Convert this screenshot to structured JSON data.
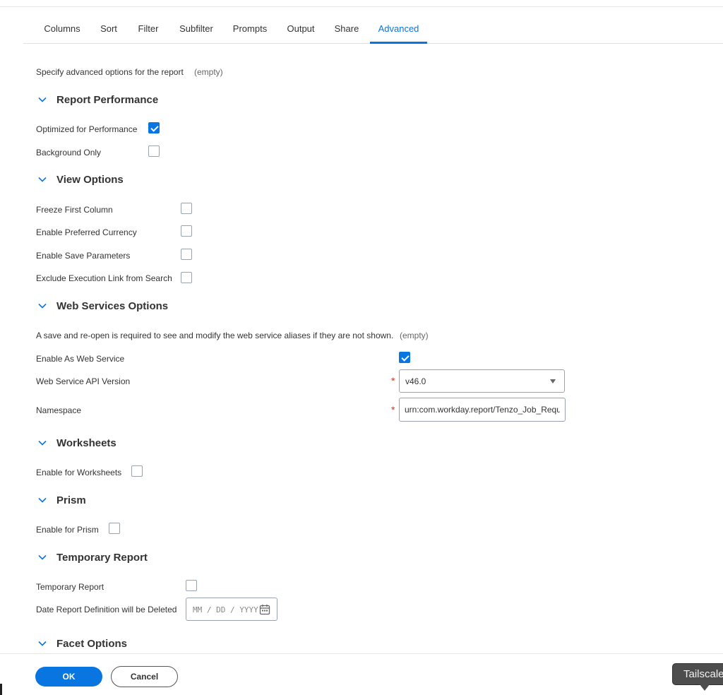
{
  "tabs": [
    "Columns",
    "Sort",
    "Filter",
    "Subfilter",
    "Prompts",
    "Output",
    "Share",
    "Advanced"
  ],
  "active_tab": "Advanced",
  "intro": {
    "label": "Specify advanced options for the report",
    "value": "(empty)"
  },
  "report_performance": {
    "title": "Report Performance",
    "optimized_label": "Optimized for Performance",
    "optimized_checked": true,
    "background_label": "Background Only",
    "background_checked": false
  },
  "view_options": {
    "title": "View Options",
    "freeze_label": "Freeze First Column",
    "freeze_checked": false,
    "currency_label": "Enable Preferred Currency",
    "currency_checked": false,
    "save_params_label": "Enable Save Parameters",
    "save_params_checked": false,
    "exclude_label": "Exclude Execution Link from Search",
    "exclude_checked": false
  },
  "web_services": {
    "title": "Web Services Options",
    "note": "A save and re-open is required to see and modify the web service aliases if they are not shown.",
    "note_value": "(empty)",
    "enable_label": "Enable As Web Service",
    "enable_checked": true,
    "api_version_label": "Web Service API Version",
    "api_version_value": "v46.0",
    "namespace_label": "Namespace",
    "namespace_value": "urn:com.workday.report/Tenzo_Job_Requisitions",
    "required_mark": "*"
  },
  "worksheets": {
    "title": "Worksheets",
    "enable_label": "Enable for Worksheets",
    "enable_checked": false
  },
  "prism": {
    "title": "Prism",
    "enable_label": "Enable for Prism",
    "enable_checked": false
  },
  "temporary_report": {
    "title": "Temporary Report",
    "temp_label": "Temporary Report",
    "temp_checked": false,
    "date_label": "Date Report Definition will be Deleted",
    "date_placeholder": "MM / DD / YYYY"
  },
  "facet_options": {
    "title": "Facet Options"
  },
  "footer": {
    "ok_label": "OK",
    "cancel_label": "Cancel"
  },
  "tooltip": {
    "text": "Tailscale"
  },
  "colors": {
    "accent": "#0875e1",
    "required": "#de2e21",
    "tooltip_bg": "#4d4d4d"
  },
  "icons": {
    "section_toggle": "chevron-down-icon",
    "date_picker": "calendar-icon",
    "dropdown": "dropdown-arrow-icon"
  }
}
